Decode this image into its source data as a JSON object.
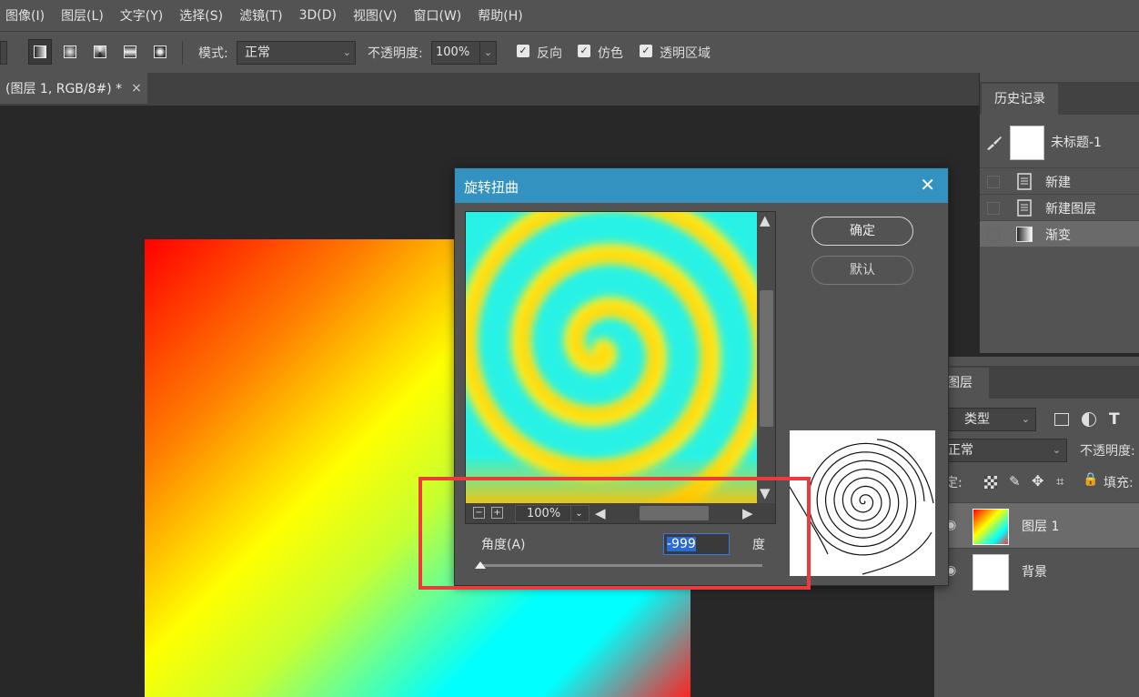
{
  "menubar": {
    "items": [
      "图像(I)",
      "图层(L)",
      "文字(Y)",
      "选择(S)",
      "滤镜(T)",
      "3D(D)",
      "视图(V)",
      "窗口(W)",
      "帮助(H)"
    ]
  },
  "options": {
    "mode_label": "模式:",
    "mode_value": "正常",
    "opacity_label": "不透明度:",
    "opacity_value": "100%",
    "reverse_label": "反向",
    "dither_label": "仿色",
    "transparency_label": "透明区域",
    "check_glyph": "✓"
  },
  "document": {
    "tab_title": "(图层 1, RGB/8#) *",
    "close_glyph": "×"
  },
  "history": {
    "tab_label": "历史记录",
    "snapshot_label": "未标题-1",
    "items": [
      {
        "label": "新建"
      },
      {
        "label": "新建图层"
      },
      {
        "label": "渐变"
      }
    ]
  },
  "layers": {
    "tab_label": "图层",
    "filter_label": "类型",
    "blend_mode": "正常",
    "opacity_label": "不透明度:",
    "lock_label": "锁定:",
    "fill_label": "填充:",
    "rows": [
      {
        "name": "图层 1"
      },
      {
        "name": "背景"
      }
    ]
  },
  "dialog": {
    "title": "旋转扭曲",
    "close_glyph": "✕",
    "ok_label": "确定",
    "default_label": "默认",
    "zoom_value": "100%",
    "zoom_out_glyph": "−",
    "zoom_in_glyph": "+",
    "angle_label": "角度(A)",
    "angle_value": "-999",
    "degree_label": "度"
  },
  "colors": {
    "dialog_titlebar": "#3392c0",
    "highlight_box": "#ee3a3a",
    "input_selection": "#2a6ad6"
  }
}
